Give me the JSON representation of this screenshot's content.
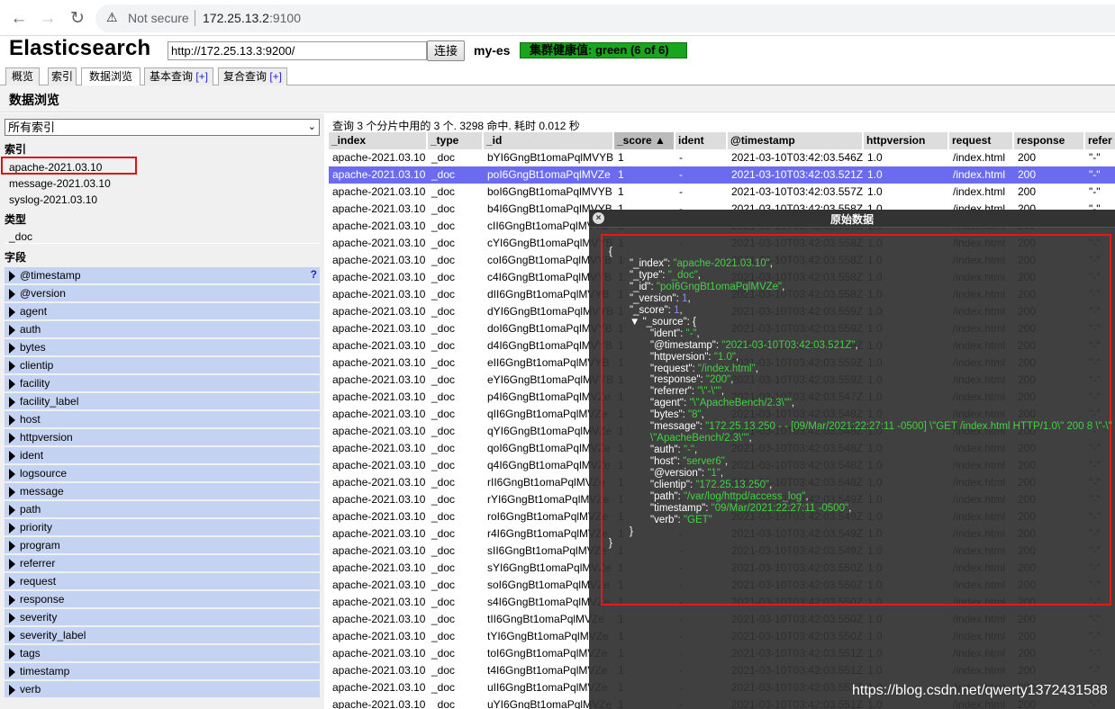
{
  "browser": {
    "security_label": "Not secure",
    "url_host": "172.25.13.2",
    "url_port": ":9100"
  },
  "app": {
    "title": "Elasticsearch",
    "cluster_url": "http://172.25.13.3:9200/",
    "connect_label": "连接",
    "cluster_name": "my-es",
    "health": "集群健康值: green (6 of 6)",
    "health_color": "#19a51d"
  },
  "tabs": [
    {
      "label": "概览",
      "plus": ""
    },
    {
      "label": "索引",
      "plus": ""
    },
    {
      "label": "数据浏览",
      "plus": ""
    },
    {
      "label": "基本查询",
      "plus": "[+]"
    },
    {
      "label": "复合查询",
      "plus": "[+]"
    }
  ],
  "section_title": "数据浏览",
  "sidebar": {
    "index_select": "所有索引",
    "indices_heading": "索引",
    "indices": [
      "apache-2021.03.10",
      "message-2021.03.10",
      "syslog-2021.03.10"
    ],
    "types_heading": "类型",
    "types": [
      "_doc"
    ],
    "fields_heading": "字段",
    "fields": [
      "@timestamp",
      "@version",
      "agent",
      "auth",
      "bytes",
      "clientip",
      "facility",
      "facility_label",
      "host",
      "httpversion",
      "ident",
      "logsource",
      "message",
      "path",
      "priority",
      "program",
      "referrer",
      "request",
      "response",
      "severity",
      "severity_label",
      "tags",
      "timestamp",
      "verb"
    ],
    "help_glyph": "?"
  },
  "results": {
    "query_info": "查询 3 个分片中用的 3 个. 3298 命中. 耗时 0.012 秒",
    "columns": [
      "_index",
      "_type",
      "_id",
      "_score  ▲",
      "ident",
      "@timestamp",
      "httpversion",
      "request",
      "response",
      "refer"
    ],
    "selected_row": 1,
    "rows": [
      [
        "apache-2021.03.10",
        "_doc",
        "bYI6GngBt1omaPqlMVYB",
        "1",
        "-",
        "2021-03-10T03:42:03.546Z",
        "1.0",
        "/index.html",
        "200",
        "\"-\""
      ],
      [
        "apache-2021.03.10",
        "_doc",
        "poI6GngBt1omaPqlMVZe",
        "1",
        "-",
        "2021-03-10T03:42:03.521Z",
        "1.0",
        "/index.html",
        "200",
        "\"-\""
      ],
      [
        "apache-2021.03.10",
        "_doc",
        "boI6GngBt1omaPqlMVYB",
        "1",
        "-",
        "2021-03-10T03:42:03.557Z",
        "1.0",
        "/index.html",
        "200",
        "\"-\""
      ],
      [
        "apache-2021.03.10",
        "_doc",
        "b4I6GngBt1omaPqlMVYB",
        "1",
        "-",
        "2021-03-10T03:42:03.558Z",
        "1.0",
        "/index.html",
        "200",
        "\"-\""
      ],
      [
        "apache-2021.03.10",
        "_doc",
        "cII6GngBt1omaPqlMVYB",
        "1",
        "-",
        "2021-03-10T03:42:03.558Z",
        "1.0",
        "/index.html",
        "200",
        "\"-\""
      ],
      [
        "apache-2021.03.10",
        "_doc",
        "cYI6GngBt1omaPqlMVYB",
        "1",
        "-",
        "2021-03-10T03:42:03.558Z",
        "1.0",
        "/index.html",
        "200",
        "\"-\""
      ],
      [
        "apache-2021.03.10",
        "_doc",
        "coI6GngBt1omaPqlMVYB",
        "1",
        "-",
        "2021-03-10T03:42:03.558Z",
        "1.0",
        "/index.html",
        "200",
        "\"-\""
      ],
      [
        "apache-2021.03.10",
        "_doc",
        "c4I6GngBt1omaPqlMVYB",
        "1",
        "-",
        "2021-03-10T03:42:03.558Z",
        "1.0",
        "/index.html",
        "200",
        "\"-\""
      ],
      [
        "apache-2021.03.10",
        "_doc",
        "dII6GngBt1omaPqlMVYB",
        "1",
        "-",
        "2021-03-10T03:42:03.558Z",
        "1.0",
        "/index.html",
        "200",
        "\"-\""
      ],
      [
        "apache-2021.03.10",
        "_doc",
        "dYI6GngBt1omaPqlMVYB",
        "1",
        "-",
        "2021-03-10T03:42:03.559Z",
        "1.0",
        "/index.html",
        "200",
        "\"-\""
      ],
      [
        "apache-2021.03.10",
        "_doc",
        "doI6GngBt1omaPqlMVYB",
        "1",
        "-",
        "2021-03-10T03:42:03.559Z",
        "1.0",
        "/index.html",
        "200",
        "\"-\""
      ],
      [
        "apache-2021.03.10",
        "_doc",
        "d4I6GngBt1omaPqlMVYB",
        "1",
        "-",
        "2021-03-10T03:42:03.559Z",
        "1.0",
        "/index.html",
        "200",
        "\"-\""
      ],
      [
        "apache-2021.03.10",
        "_doc",
        "eII6GngBt1omaPqlMVYB",
        "1",
        "-",
        "2021-03-10T03:42:03.559Z",
        "1.0",
        "/index.html",
        "200",
        "\"-\""
      ],
      [
        "apache-2021.03.10",
        "_doc",
        "eYI6GngBt1omaPqlMVYB",
        "1",
        "-",
        "2021-03-10T03:42:03.559Z",
        "1.0",
        "/index.html",
        "200",
        "\"-\""
      ],
      [
        "apache-2021.03.10",
        "_doc",
        "p4I6GngBt1omaPqlMVZe",
        "1",
        "-",
        "2021-03-10T03:42:03.547Z",
        "1.0",
        "/index.html",
        "200",
        "\"-\""
      ],
      [
        "apache-2021.03.10",
        "_doc",
        "qII6GngBt1omaPqlMVZe",
        "1",
        "-",
        "2021-03-10T03:42:03.548Z",
        "1.0",
        "/index.html",
        "200",
        "\"-\""
      ],
      [
        "apache-2021.03.10",
        "_doc",
        "qYI6GngBt1omaPqlMVZe",
        "1",
        "-",
        "2021-03-10T03:42:03.548Z",
        "1.0",
        "/index.html",
        "200",
        "\"-\""
      ],
      [
        "apache-2021.03.10",
        "_doc",
        "qoI6GngBt1omaPqlMVZe",
        "1",
        "-",
        "2021-03-10T03:42:03.548Z",
        "1.0",
        "/index.html",
        "200",
        "\"-\""
      ],
      [
        "apache-2021.03.10",
        "_doc",
        "q4I6GngBt1omaPqlMVZe",
        "1",
        "-",
        "2021-03-10T03:42:03.548Z",
        "1.0",
        "/index.html",
        "200",
        "\"-\""
      ],
      [
        "apache-2021.03.10",
        "_doc",
        "rII6GngBt1omaPqlMVZe",
        "1",
        "-",
        "2021-03-10T03:42:03.548Z",
        "1.0",
        "/index.html",
        "200",
        "\"-\""
      ],
      [
        "apache-2021.03.10",
        "_doc",
        "rYI6GngBt1omaPqlMVZe",
        "1",
        "-",
        "2021-03-10T03:42:03.549Z",
        "1.0",
        "/index.html",
        "200",
        "\"-\""
      ],
      [
        "apache-2021.03.10",
        "_doc",
        "roI6GngBt1omaPqlMVZe",
        "1",
        "-",
        "2021-03-10T03:42:03.549Z",
        "1.0",
        "/index.html",
        "200",
        "\"-\""
      ],
      [
        "apache-2021.03.10",
        "_doc",
        "r4I6GngBt1omaPqlMVZe",
        "1",
        "-",
        "2021-03-10T03:42:03.549Z",
        "1.0",
        "/index.html",
        "200",
        "\"-\""
      ],
      [
        "apache-2021.03.10",
        "_doc",
        "sII6GngBt1omaPqlMVZe",
        "1",
        "-",
        "2021-03-10T03:42:03.549Z",
        "1.0",
        "/index.html",
        "200",
        "\"-\""
      ],
      [
        "apache-2021.03.10",
        "_doc",
        "sYI6GngBt1omaPqlMVZe",
        "1",
        "-",
        "2021-03-10T03:42:03.550Z",
        "1.0",
        "/index.html",
        "200",
        "\"-\""
      ],
      [
        "apache-2021.03.10",
        "_doc",
        "soI6GngBt1omaPqlMVZe",
        "1",
        "-",
        "2021-03-10T03:42:03.550Z",
        "1.0",
        "/index.html",
        "200",
        "\"-\""
      ],
      [
        "apache-2021.03.10",
        "_doc",
        "s4I6GngBt1omaPqlMVZe",
        "1",
        "-",
        "2021-03-10T03:42:03.550Z",
        "1.0",
        "/index.html",
        "200",
        "\"-\""
      ],
      [
        "apache-2021.03.10",
        "_doc",
        "tII6GngBt1omaPqlMVZe",
        "1",
        "-",
        "2021-03-10T03:42:03.550Z",
        "1.0",
        "/index.html",
        "200",
        "\"-\""
      ],
      [
        "apache-2021.03.10",
        "_doc",
        "tYI6GngBt1omaPqlMVZe",
        "1",
        "-",
        "2021-03-10T03:42:03.550Z",
        "1.0",
        "/index.html",
        "200",
        "\"-\""
      ],
      [
        "apache-2021.03.10",
        "_doc",
        "toI6GngBt1omaPqlMVZe",
        "1",
        "-",
        "2021-03-10T03:42:03.551Z",
        "1.0",
        "/index.html",
        "200",
        "\"-\""
      ],
      [
        "apache-2021.03.10",
        "_doc",
        "t4I6GngBt1omaPqlMVZe",
        "1",
        "-",
        "2021-03-10T03:42:03.551Z",
        "1.0",
        "/index.html",
        "200",
        "\"-\""
      ],
      [
        "apache-2021.03.10",
        "_doc",
        "uII6GngBt1omaPqlMVZe",
        "1",
        "-",
        "2021-03-10T03:42:03.551Z",
        "1.0",
        "/index.html",
        "200",
        "\"-\""
      ],
      [
        "apache-2021.03.10",
        "_doc",
        "uYI6GngBt1omaPqlMVZe",
        "1",
        "-",
        "2021-03-10T03:42:03.551Z",
        "1.0",
        "/index.html",
        "200",
        "\"-\""
      ]
    ]
  },
  "modal": {
    "title": "原始数据",
    "close_glyph": "×",
    "json_lines": [
      {
        "indent": 0,
        "parts": [
          [
            "k",
            "{"
          ]
        ]
      },
      {
        "indent": 1,
        "parts": [
          [
            "k",
            "\"_index\": "
          ],
          [
            "s",
            "\"apache-2021.03.10\""
          ],
          [
            "k",
            ","
          ]
        ]
      },
      {
        "indent": 1,
        "parts": [
          [
            "k",
            "\"_type\": "
          ],
          [
            "s",
            "\"_doc\""
          ],
          [
            "k",
            ","
          ]
        ]
      },
      {
        "indent": 1,
        "parts": [
          [
            "k",
            "\"_id\": "
          ],
          [
            "s",
            "\"poI6GngBt1omaPqlMVZe\""
          ],
          [
            "k",
            ","
          ]
        ]
      },
      {
        "indent": 1,
        "parts": [
          [
            "k",
            "\"_version\": "
          ],
          [
            "n",
            "1"
          ],
          [
            "k",
            ","
          ]
        ]
      },
      {
        "indent": 1,
        "parts": [
          [
            "k",
            "\"_score\": "
          ],
          [
            "n",
            "1"
          ],
          [
            "k",
            ","
          ]
        ]
      },
      {
        "indent": 1,
        "parts": [
          [
            "k",
            "▼ \"_source\": {"
          ]
        ]
      },
      {
        "indent": 2,
        "parts": [
          [
            "k",
            "\"ident\": "
          ],
          [
            "s",
            "\"-\""
          ],
          [
            "k",
            ","
          ]
        ]
      },
      {
        "indent": 2,
        "parts": [
          [
            "k",
            "\"@timestamp\": "
          ],
          [
            "s",
            "\"2021-03-10T03:42:03.521Z\""
          ],
          [
            "k",
            ","
          ]
        ]
      },
      {
        "indent": 2,
        "parts": [
          [
            "k",
            "\"httpversion\": "
          ],
          [
            "s",
            "\"1.0\""
          ],
          [
            "k",
            ","
          ]
        ]
      },
      {
        "indent": 2,
        "parts": [
          [
            "k",
            "\"request\": "
          ],
          [
            "s",
            "\"/index.html\""
          ],
          [
            "k",
            ","
          ]
        ]
      },
      {
        "indent": 2,
        "parts": [
          [
            "k",
            "\"response\": "
          ],
          [
            "s",
            "\"200\""
          ],
          [
            "k",
            ","
          ]
        ]
      },
      {
        "indent": 2,
        "parts": [
          [
            "k",
            "\"referrer\": "
          ],
          [
            "s",
            "\"\\\"-\\\"\""
          ],
          [
            "k",
            ","
          ]
        ]
      },
      {
        "indent": 2,
        "parts": [
          [
            "k",
            "\"agent\": "
          ],
          [
            "s",
            "\"\\\"ApacheBench/2.3\\\"\""
          ],
          [
            "k",
            ","
          ]
        ]
      },
      {
        "indent": 2,
        "parts": [
          [
            "k",
            "\"bytes\": "
          ],
          [
            "s",
            "\"8\""
          ],
          [
            "k",
            ","
          ]
        ]
      },
      {
        "indent": 2,
        "parts": [
          [
            "k",
            "\"message\": "
          ],
          [
            "s",
            "\"172.25.13.250 - - [09/Mar/2021:22:27:11 -0500] \\\"GET /index.html HTTP/1.0\\\" 200 8 \\\"-\\\""
          ]
        ]
      },
      {
        "indent": 2,
        "parts": [
          [
            "s",
            "\\\"ApacheBench/2.3\\\"\""
          ],
          [
            "k",
            ","
          ]
        ]
      },
      {
        "indent": 2,
        "parts": [
          [
            "k",
            "\"auth\": "
          ],
          [
            "s",
            "\"-\""
          ],
          [
            "k",
            ","
          ]
        ]
      },
      {
        "indent": 2,
        "parts": [
          [
            "k",
            "\"host\": "
          ],
          [
            "s",
            "\"server6\""
          ],
          [
            "k",
            ","
          ]
        ]
      },
      {
        "indent": 2,
        "parts": [
          [
            "k",
            "\"@version\": "
          ],
          [
            "s",
            "\"1\""
          ],
          [
            "k",
            ","
          ]
        ]
      },
      {
        "indent": 2,
        "parts": [
          [
            "k",
            "\"clientip\": "
          ],
          [
            "s",
            "\"172.25.13.250\""
          ],
          [
            "k",
            ","
          ]
        ]
      },
      {
        "indent": 2,
        "parts": [
          [
            "k",
            "\"path\": "
          ],
          [
            "s",
            "\"/var/log/httpd/access_log\""
          ],
          [
            "k",
            ","
          ]
        ]
      },
      {
        "indent": 2,
        "parts": [
          [
            "k",
            "\"timestamp\": "
          ],
          [
            "s",
            "\"09/Mar/2021:22:27:11 -0500\""
          ],
          [
            "k",
            ","
          ]
        ]
      },
      {
        "indent": 2,
        "parts": [
          [
            "k",
            "\"verb\": "
          ],
          [
            "s",
            "\"GET\""
          ]
        ]
      },
      {
        "indent": 1,
        "parts": [
          [
            "k",
            "}"
          ]
        ]
      },
      {
        "indent": 0,
        "parts": [
          [
            "k",
            "}"
          ]
        ]
      }
    ]
  },
  "watermark": "https://blog.csdn.net/qwerty1372431588"
}
